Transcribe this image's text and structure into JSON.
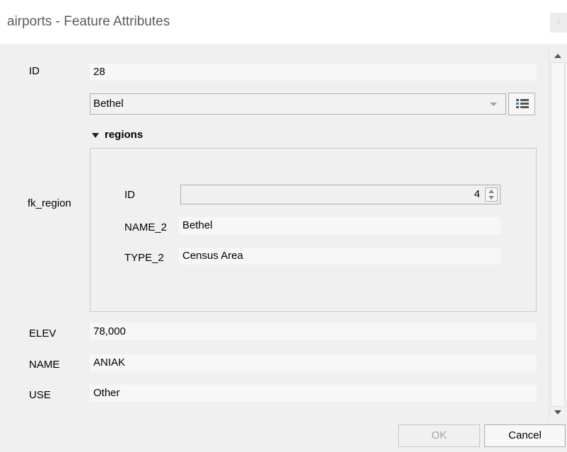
{
  "window": {
    "title": "airports - Feature Attributes",
    "close_label": "×"
  },
  "form": {
    "id": {
      "label": "ID",
      "value": "28"
    },
    "fk_region": {
      "label": "fk_region",
      "combo_value": "Bethel",
      "group_title": "regions",
      "sub": {
        "id": {
          "label": "ID",
          "value": "4"
        },
        "name_2": {
          "label": "NAME_2",
          "value": "Bethel"
        },
        "type_2": {
          "label": "TYPE_2",
          "value": "Census Area"
        }
      }
    },
    "elev": {
      "label": "ELEV",
      "value": "78,000"
    },
    "name": {
      "label": "NAME",
      "value": "ANIAK"
    },
    "use": {
      "label": "USE",
      "value": "Other"
    }
  },
  "buttons": {
    "ok": "OK",
    "cancel": "Cancel"
  },
  "icons": {
    "close": "close-icon",
    "dropdown": "chevron-down-icon",
    "open_form": "list-form-icon",
    "collapse": "triangle-down-icon",
    "spin_up": "spin-up-icon",
    "spin_down": "spin-down-icon",
    "scroll_up": "scroll-up-icon",
    "scroll_down": "scroll-down-icon"
  }
}
